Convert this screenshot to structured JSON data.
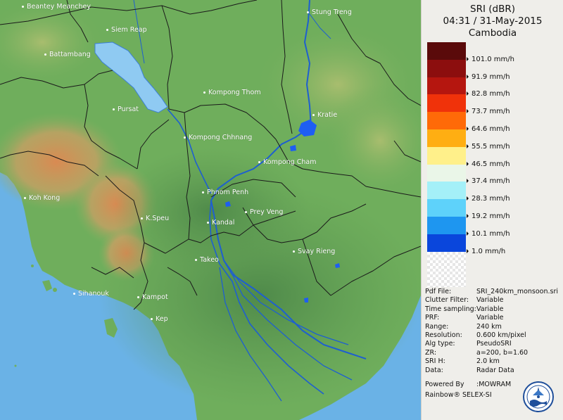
{
  "panel": {
    "title_line1": "SRI (dBR)",
    "title_line2": "04:31 / 31-May-2015",
    "title_line3": "Cambodia"
  },
  "legend": [
    {
      "label": "101.0 mm/h",
      "color": "#5a0a0a"
    },
    {
      "label": "91.9 mm/h",
      "color": "#8c0e0e"
    },
    {
      "label": "82.8 mm/h",
      "color": "#b5160f"
    },
    {
      "label": "73.7 mm/h",
      "color": "#f0320a"
    },
    {
      "label": "64.6 mm/h",
      "color": "#ff6a08"
    },
    {
      "label": "55.5 mm/h",
      "color": "#ffae12"
    },
    {
      "label": "46.5 mm/h",
      "color": "#fff08a"
    },
    {
      "label": "37.4 mm/h",
      "color": "#eaf6e8"
    },
    {
      "label": "28.3 mm/h",
      "color": "#a4f0f8"
    },
    {
      "label": "19.2 mm/h",
      "color": "#5ed2fa"
    },
    {
      "label": "10.1 mm/h",
      "color": "#1e96f0"
    },
    {
      "label": "1.0 mm/h",
      "color": "#0a46dc"
    }
  ],
  "info": [
    {
      "key": "Pdf File:",
      "value": "SRI_240km_monsoon.sri"
    },
    {
      "key": "Clutter Filter:",
      "value": "Variable"
    },
    {
      "key": "Time sampling:",
      "value": "Variable"
    },
    {
      "key": "PRF:",
      "value": "Variable"
    },
    {
      "key": "Range:",
      "value": "240 km"
    },
    {
      "key": "Resolution:",
      "value": "0.600 km/pixel"
    },
    {
      "key": "Alg type:",
      "value": "PseudoSRI"
    },
    {
      "key": "ZR:",
      "value": "a=200, b=1.60"
    },
    {
      "key": "SRI H:",
      "value": "2.0 km"
    },
    {
      "key": "Data:",
      "value": "Radar Data"
    }
  ],
  "footer": {
    "powered_by": "Powered By",
    "powered_value": ":MOWRAM",
    "rainbow": "Rainbow® SELEX-SI"
  },
  "cities": [
    {
      "name": "Beantey Meanchey",
      "id": "beantey-meanchey"
    },
    {
      "name": "Siem Reap",
      "id": "siem-reap"
    },
    {
      "name": "Battambang",
      "id": "battambang"
    },
    {
      "name": "Stung Treng",
      "id": "stung-treng"
    },
    {
      "name": "Kompong Thom",
      "id": "kompong-thom"
    },
    {
      "name": "Pursat",
      "id": "pursat"
    },
    {
      "name": "Kratie",
      "id": "kratie"
    },
    {
      "name": "Kompong Chhnang",
      "id": "kompong-chhnang"
    },
    {
      "name": "Kompong Cham",
      "id": "kompong-cham"
    },
    {
      "name": "Phnom Penh",
      "id": "phnom-penh"
    },
    {
      "name": "Koh Kong",
      "id": "koh-kong"
    },
    {
      "name": "Prey Veng",
      "id": "prey-veng"
    },
    {
      "name": "K.Speu",
      "id": "k-speu"
    },
    {
      "name": "Kandal",
      "id": "kandal"
    },
    {
      "name": "Svay Rieng",
      "id": "svay-rieng"
    },
    {
      "name": "Takeo",
      "id": "takeo"
    },
    {
      "name": "Sihanouk",
      "id": "sihanouk"
    },
    {
      "name": "Kampot",
      "id": "kampot"
    },
    {
      "name": "Kep",
      "id": "kep"
    }
  ],
  "colors": {
    "sea": "#6ab2e6",
    "lowland": "#5e9a52",
    "forest": "#6fae5c",
    "highland": "#a9b870",
    "mountain": "#d89258",
    "lake": "#8fcaf2",
    "river": "#1e5fd0",
    "rain": "#1e5ef2"
  }
}
